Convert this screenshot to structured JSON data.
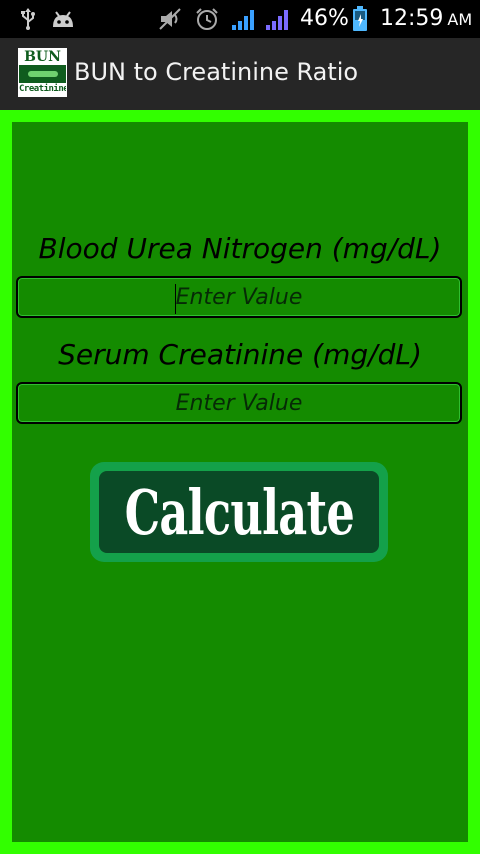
{
  "status_bar": {
    "battery_percent": "46%",
    "time": "12:59",
    "ampm": "AM",
    "icons": [
      "usb-icon",
      "android-debug-icon",
      "mute-icon",
      "alarm-icon",
      "signal-icon",
      "signal-icon-2",
      "battery-icon"
    ]
  },
  "action_bar": {
    "logo": {
      "line1": "BUN",
      "line2": "Creatinine"
    },
    "title": "BUN to Creatinine Ratio"
  },
  "form": {
    "bun": {
      "label": "Blood Urea Nitrogen (mg/dL)",
      "placeholder": "Enter Value",
      "value": ""
    },
    "creatinine": {
      "label": "Serum Creatinine (mg/dL)",
      "placeholder": "Enter Value",
      "value": ""
    },
    "calculate_label": "Calculate"
  },
  "colors": {
    "frame": "#32ff00",
    "panel": "#148b00",
    "button_outer": "#14a14a",
    "button_inner": "#0a4a26",
    "action_bar": "#262626"
  }
}
